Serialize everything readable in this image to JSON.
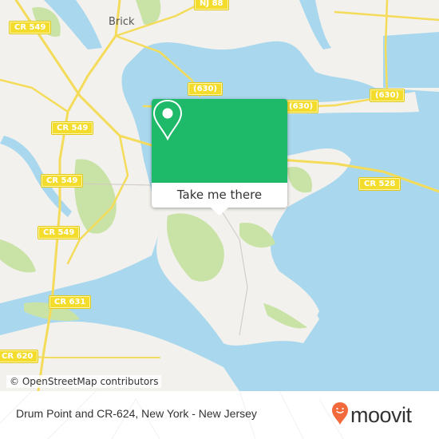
{
  "map": {
    "place_labels": [
      {
        "text": "Brick"
      }
    ],
    "road_shields": [
      {
        "text": "CR 549"
      },
      {
        "text": "NJ 88"
      },
      {
        "text": "(630)"
      },
      {
        "text": "(630)"
      },
      {
        "text": "(630)"
      },
      {
        "text": "CR 549"
      },
      {
        "text": "CR 549"
      },
      {
        "text": "CR 549"
      },
      {
        "text": "CR 528"
      },
      {
        "text": "CR 631"
      },
      {
        "text": "CR 620"
      }
    ],
    "attribution": "© OpenStreetMap contributors",
    "colors": {
      "land": "#f2f1ed",
      "water": "#a9d8ee",
      "park": "#c9e2a6",
      "road": "#f4dc5a"
    }
  },
  "popup": {
    "icon": "map-pin-icon",
    "button_label": "Take me there",
    "color": "#1fb96a"
  },
  "footer": {
    "title": "Drum Point and CR-624, New York - New Jersey",
    "brand": "moovit",
    "brand_color": "#f26a3b"
  }
}
